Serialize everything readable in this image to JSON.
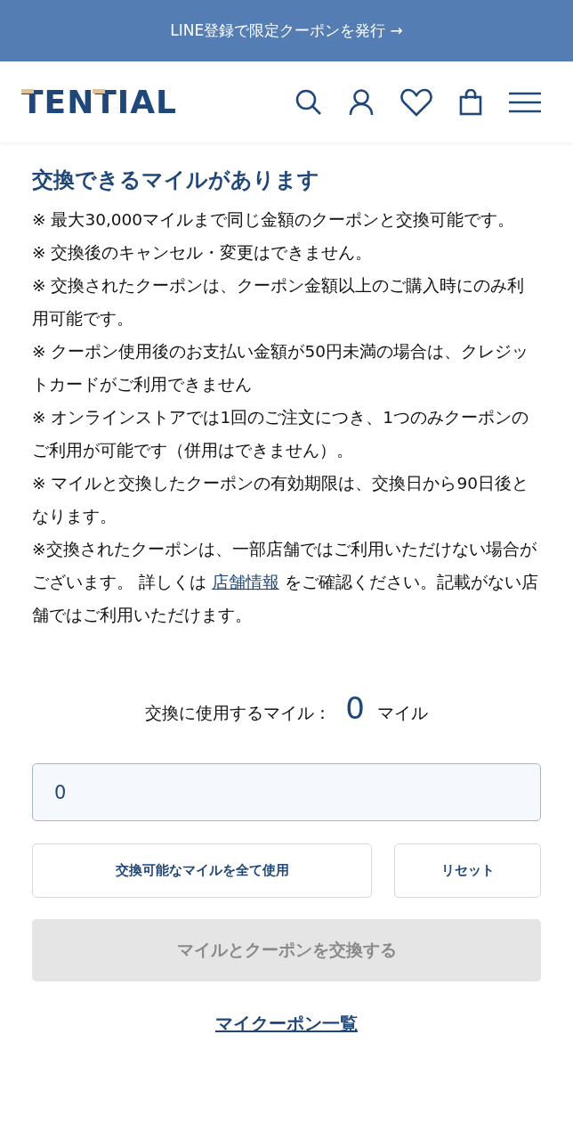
{
  "banner": {
    "text": "LINE登録で限定クーポンを発行 →"
  },
  "header": {
    "logo": "TENTIAL"
  },
  "heading": "交換できるマイルがあります",
  "notes": [
    {
      "kind": "plain",
      "text": "※ 最大30,000マイルまで同じ金額のクーポンと交換可能です。"
    },
    {
      "kind": "plain",
      "text": "※ 交換後のキャンセル・変更はできません。"
    },
    {
      "kind": "plain",
      "text": "※ 交換されたクーポンは、クーポン金額以上のご購入時にのみ利用可能です。"
    },
    {
      "kind": "plain",
      "text": "※ クーポン使用後のお支払い金額が50円未満の場合は、クレジットカードがご利用できません"
    },
    {
      "kind": "plain",
      "text": "※ オンラインストアでは1回のご注文につき、1つのみクーポンのご利用が可能です（併用はできません）。"
    },
    {
      "kind": "plain",
      "text": "※ マイルと交換したクーポンの有効期限は、交換日から90日後となります。"
    },
    {
      "kind": "link",
      "before": "※交換されたクーポンは、一部店舗ではご利用いただけない場合がございます。 詳しくは ",
      "link": "店舗情報",
      "after": " をご確認ください。記載がない店舗ではご利用いただけます。"
    }
  ],
  "miles": {
    "label": "交換に使用するマイル：",
    "value": "0",
    "unit": "マイル"
  },
  "miles_input": {
    "value": "0"
  },
  "use_all_button": {
    "label": "交換可能なマイルを全て使用"
  },
  "reset_button": {
    "label": "リセット"
  },
  "exchange_button": {
    "label": "マイルとクーポンを交換する",
    "disabled": true
  },
  "coupon_link": "マイクーポン一覧"
}
